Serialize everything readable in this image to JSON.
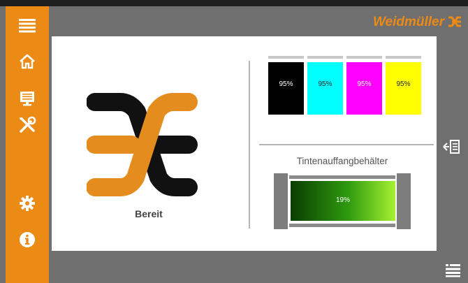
{
  "brand": {
    "name": "Weidmüller",
    "accent": "#ec8a16"
  },
  "sidebar": {
    "items": [
      {
        "icon": "menu-icon"
      },
      {
        "icon": "home-icon"
      },
      {
        "icon": "monitor-list-icon"
      },
      {
        "icon": "tools-icon"
      },
      {
        "icon": "gear-icon"
      },
      {
        "icon": "info-icon"
      }
    ]
  },
  "status": {
    "label": "Bereit"
  },
  "cartridges": [
    {
      "color": "#000000",
      "level_percent": 95,
      "label": "95%"
    },
    {
      "color": "#00ffff",
      "level_percent": 95,
      "label": "95%"
    },
    {
      "color": "#ff00ff",
      "level_percent": 95,
      "label": "95%"
    },
    {
      "color": "#ffff00",
      "level_percent": 95,
      "label": "95%"
    }
  ],
  "waste": {
    "title": "Tintenauffangbehälter",
    "level_percent": 19,
    "label": "19%"
  },
  "right_controls": [
    {
      "icon": "collapse-panel-icon"
    },
    {
      "icon": "options-list-icon"
    }
  ]
}
